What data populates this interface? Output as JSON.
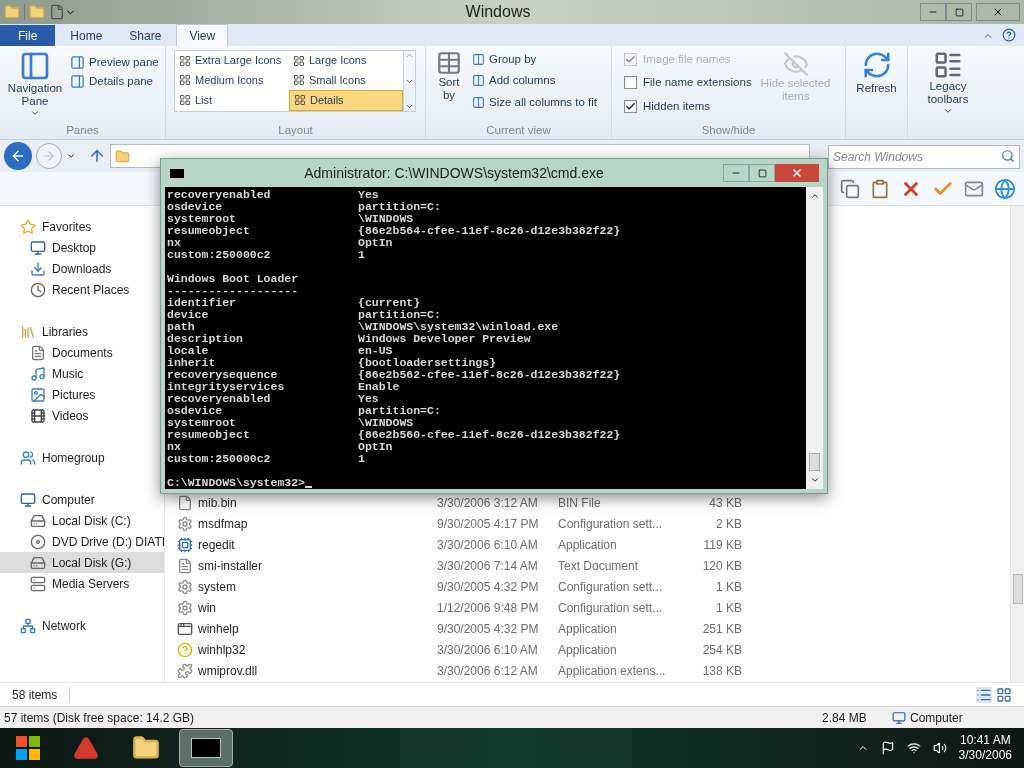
{
  "window": {
    "title": "Windows"
  },
  "ribbon": {
    "tabs": [
      {
        "label": "File",
        "kind": "file",
        "selected": false
      },
      {
        "label": "Home",
        "kind": "tab",
        "selected": false
      },
      {
        "label": "Share",
        "kind": "tab",
        "selected": false
      },
      {
        "label": "View",
        "kind": "tab",
        "selected": true
      }
    ],
    "panes": {
      "label": "Panes",
      "big": "Navigation Pane",
      "small": [
        "Preview pane",
        "Details pane"
      ]
    },
    "layout": {
      "label": "Layout",
      "items": [
        {
          "label": "Extra Large Icons",
          "selected": false
        },
        {
          "label": "Large Icons",
          "selected": false
        },
        {
          "label": "Medium Icons",
          "selected": false
        },
        {
          "label": "Small Icons",
          "selected": false
        },
        {
          "label": "List",
          "selected": false
        },
        {
          "label": "Details",
          "selected": true
        }
      ]
    },
    "current_view": {
      "label": "Current view",
      "sort": "Sort by",
      "items": [
        "Group by",
        "Add columns",
        "Size all columns to fit"
      ]
    },
    "show_hide": {
      "label": "Show/hide",
      "options": [
        {
          "label": "Image file names",
          "checked": true,
          "disabled": true
        },
        {
          "label": "File name extensions",
          "checked": false,
          "disabled": false
        },
        {
          "label": "Hidden items",
          "checked": true,
          "disabled": false
        }
      ],
      "hide_selected": {
        "label": "Hide selected items",
        "disabled": true
      }
    },
    "refresh": "Refresh",
    "legacy": "Legacy toolbars"
  },
  "search": {
    "placeholder": "Search Windows"
  },
  "sidebar": {
    "groups": [
      {
        "label": "Favorites",
        "kind": "star",
        "selected": false,
        "children": [
          {
            "label": "Desktop",
            "kind": "desktop",
            "selected": false
          },
          {
            "label": "Downloads",
            "kind": "download",
            "selected": false
          },
          {
            "label": "Recent Places",
            "kind": "recent",
            "selected": false
          }
        ]
      },
      {
        "label": "Libraries",
        "kind": "library",
        "selected": false,
        "children": [
          {
            "label": "Documents",
            "kind": "document",
            "selected": false
          },
          {
            "label": "Music",
            "kind": "music",
            "selected": false
          },
          {
            "label": "Pictures",
            "kind": "picture",
            "selected": false
          },
          {
            "label": "Videos",
            "kind": "video",
            "selected": false
          }
        ]
      },
      {
        "label": "Homegroup",
        "kind": "homegroup",
        "selected": false
      },
      {
        "label": "Computer",
        "kind": "computer",
        "selected": false,
        "children": [
          {
            "label": "Local Disk (C:)",
            "kind": "disk",
            "selected": false
          },
          {
            "label": "DVD Drive (D:) DIATI",
            "kind": "dvd",
            "selected": false
          },
          {
            "label": "Local Disk (G:)",
            "kind": "disk",
            "selected": true
          },
          {
            "label": "Media Servers",
            "kind": "media",
            "selected": false
          }
        ]
      },
      {
        "label": "Network",
        "kind": "network",
        "selected": false
      }
    ]
  },
  "files": [
    {
      "name": "mib.bin",
      "date": "3/30/2006 3:12 AM",
      "type": "BIN File",
      "size": "43 KB",
      "kind": "blank"
    },
    {
      "name": "msdfmap",
      "date": "9/30/2005 4:17 PM",
      "type": "Configuration sett...",
      "size": "2 KB",
      "kind": "config"
    },
    {
      "name": "regedit",
      "date": "3/30/2006 6:10 AM",
      "type": "Application",
      "size": "119 KB",
      "kind": "registry"
    },
    {
      "name": "smi-installer",
      "date": "3/30/2006 7:14 AM",
      "type": "Text Document",
      "size": "120 KB",
      "kind": "text"
    },
    {
      "name": "system",
      "date": "9/30/2005 4:32 PM",
      "type": "Configuration sett...",
      "size": "1 KB",
      "kind": "config"
    },
    {
      "name": "win",
      "date": "1/12/2006 9:48 PM",
      "type": "Configuration sett...",
      "size": "1 KB",
      "kind": "config"
    },
    {
      "name": "winhelp",
      "date": "9/30/2005 4:32 PM",
      "type": "Application",
      "size": "251 KB",
      "kind": "app"
    },
    {
      "name": "winhlp32",
      "date": "3/30/2006 6:10 AM",
      "type": "Application",
      "size": "254 KB",
      "kind": "help"
    },
    {
      "name": "wmiprov.dll",
      "date": "3/30/2006 6:12 AM",
      "type": "Application extens...",
      "size": "138 KB",
      "kind": "dll"
    }
  ],
  "item_count": "58 items",
  "status_bar": {
    "left": "57 items (Disk free space: 14.2 GB)",
    "size": "2.84 MB",
    "location": "Computer"
  },
  "console": {
    "title": "Administrator: C:\\WINDOWS\\system32\\cmd.exe",
    "lines": [
      {
        "kind": "pair",
        "key": "recoveryenabled",
        "value": "Yes"
      },
      {
        "kind": "pair",
        "key": "osdevice",
        "value": "partition=C:"
      },
      {
        "kind": "pair",
        "key": "systemroot",
        "value": "\\WINDOWS"
      },
      {
        "kind": "pair",
        "key": "resumeobject",
        "value": "{86e2b564-cfee-11ef-8c26-d12e3b382f22}"
      },
      {
        "kind": "pair",
        "key": "nx",
        "value": "OptIn"
      },
      {
        "kind": "pair",
        "key": "custom:250000c2",
        "value": "1"
      },
      {
        "kind": "blank"
      },
      {
        "kind": "heading",
        "text": "Windows Boot Loader"
      },
      {
        "kind": "heading",
        "text": "-------------------"
      },
      {
        "kind": "pair",
        "key": "identifier",
        "value": "{current}"
      },
      {
        "kind": "pair",
        "key": "device",
        "value": "partition=C:"
      },
      {
        "kind": "pair",
        "key": "path",
        "value": "\\WINDOWS\\system32\\winload.exe"
      },
      {
        "kind": "pair",
        "key": "description",
        "value": "Windows Developer Preview"
      },
      {
        "kind": "pair",
        "key": "locale",
        "value": "en-US"
      },
      {
        "kind": "pair",
        "key": "inherit",
        "value": "{bootloadersettings}"
      },
      {
        "kind": "pair",
        "key": "recoverysequence",
        "value": "{86e2b562-cfee-11ef-8c26-d12e3b382f22}"
      },
      {
        "kind": "pair",
        "key": "integrityservices",
        "value": "Enable"
      },
      {
        "kind": "pair",
        "key": "recoveryenabled",
        "value": "Yes"
      },
      {
        "kind": "pair",
        "key": "osdevice",
        "value": "partition=C:"
      },
      {
        "kind": "pair",
        "key": "systemroot",
        "value": "\\WINDOWS"
      },
      {
        "kind": "pair",
        "key": "resumeobject",
        "value": "{86e2b560-cfee-11ef-8c26-d12e3b382f22}"
      },
      {
        "kind": "pair",
        "key": "nx",
        "value": "OptIn"
      },
      {
        "kind": "pair",
        "key": "custom:250000c2",
        "value": "1"
      },
      {
        "kind": "blank"
      },
      {
        "kind": "prompt",
        "text": "C:\\WINDOWS\\system32>"
      }
    ]
  },
  "taskbar": {
    "apps": [
      {
        "kind": "red",
        "selected": false
      },
      {
        "kind": "explorer",
        "selected": false
      },
      {
        "kind": "console",
        "selected": true
      }
    ],
    "time": "10:41 AM",
    "date": "3/30/2006"
  }
}
